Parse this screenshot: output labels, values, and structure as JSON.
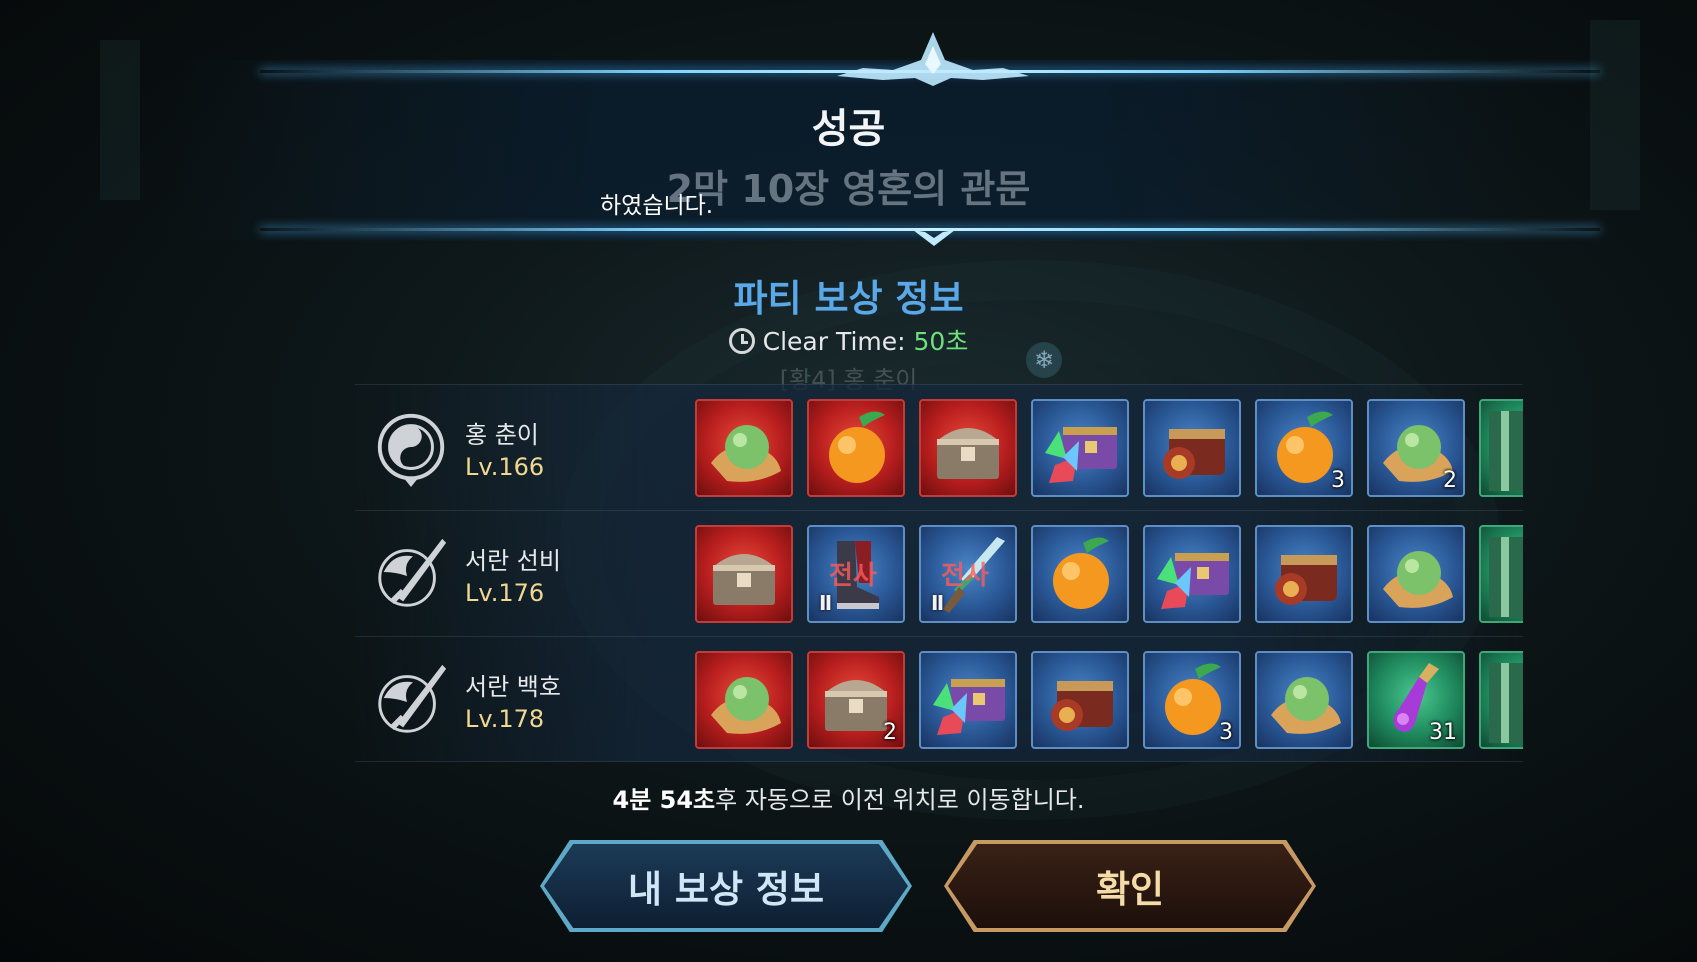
{
  "header": {
    "title": "성공",
    "subtitle": "2막 10장 영혼의 관문",
    "overlay_message": "하였습니다."
  },
  "reward": {
    "title": "파티 보상 정보",
    "clear_time_label": "Clear Time:",
    "clear_time_value": "50초",
    "ghost_name": "[황4] 홍 춘이"
  },
  "players": [
    {
      "name": "홍 춘이",
      "level": "Lv.166",
      "emblem": "yin-yang-crest-icon",
      "items": [
        {
          "icon": "green-orb-icon",
          "bg": "red",
          "count": ""
        },
        {
          "icon": "orange-fruit-icon",
          "bg": "red",
          "count": ""
        },
        {
          "icon": "treasure-chest-icon",
          "bg": "red",
          "count": ""
        },
        {
          "icon": "crystal-chest-icon",
          "bg": "blue",
          "count": ""
        },
        {
          "icon": "ornate-chest-icon",
          "bg": "blue",
          "count": ""
        },
        {
          "icon": "orange-fruit-icon",
          "bg": "blue",
          "count": "3"
        },
        {
          "icon": "green-orb-icon",
          "bg": "blue",
          "count": "2"
        },
        {
          "icon": "scroll-icon",
          "bg": "green",
          "count": ""
        }
      ]
    },
    {
      "name": "서란 선비",
      "level": "Lv.176",
      "emblem": "dragon-sword-crest-icon",
      "items": [
        {
          "icon": "treasure-chest-icon",
          "bg": "red",
          "count": ""
        },
        {
          "icon": "boots-icon",
          "bg": "blue",
          "count": "",
          "tag": "전사",
          "roman": "Ⅱ"
        },
        {
          "icon": "dagger-icon",
          "bg": "blue",
          "count": "",
          "tag": "전사",
          "roman": "Ⅱ"
        },
        {
          "icon": "orange-fruit-icon",
          "bg": "blue",
          "count": ""
        },
        {
          "icon": "crystal-chest-icon",
          "bg": "blue",
          "count": ""
        },
        {
          "icon": "ornate-chest-icon",
          "bg": "blue",
          "count": ""
        },
        {
          "icon": "green-orb-icon",
          "bg": "blue",
          "count": ""
        },
        {
          "icon": "scroll-icon",
          "bg": "green",
          "count": ""
        }
      ]
    },
    {
      "name": "서란 백호",
      "level": "Lv.178",
      "emblem": "dragon-sword-crest-icon",
      "items": [
        {
          "icon": "green-orb-icon",
          "bg": "red",
          "count": ""
        },
        {
          "icon": "treasure-chest-icon",
          "bg": "red",
          "count": "2"
        },
        {
          "icon": "crystal-chest-icon",
          "bg": "blue",
          "count": ""
        },
        {
          "icon": "ornate-chest-icon",
          "bg": "blue",
          "count": ""
        },
        {
          "icon": "orange-fruit-icon",
          "bg": "blue",
          "count": "3"
        },
        {
          "icon": "green-orb-icon",
          "bg": "blue",
          "count": ""
        },
        {
          "icon": "potion-vial-icon",
          "bg": "green",
          "count": "31"
        },
        {
          "icon": "scroll-icon",
          "bg": "green",
          "count": ""
        }
      ]
    }
  ],
  "auto_move": {
    "time": "4분 54초",
    "text": "후 자동으로 이전 위치로 이동합니다."
  },
  "buttons": {
    "my_reward": "내 보상 정보",
    "confirm": "확인"
  },
  "colors": {
    "accent_blue": "#5aa8e8",
    "clear_time_green": "#6ee07a",
    "level_gold": "#f0d890",
    "confirm_gold": "#c79a63"
  }
}
